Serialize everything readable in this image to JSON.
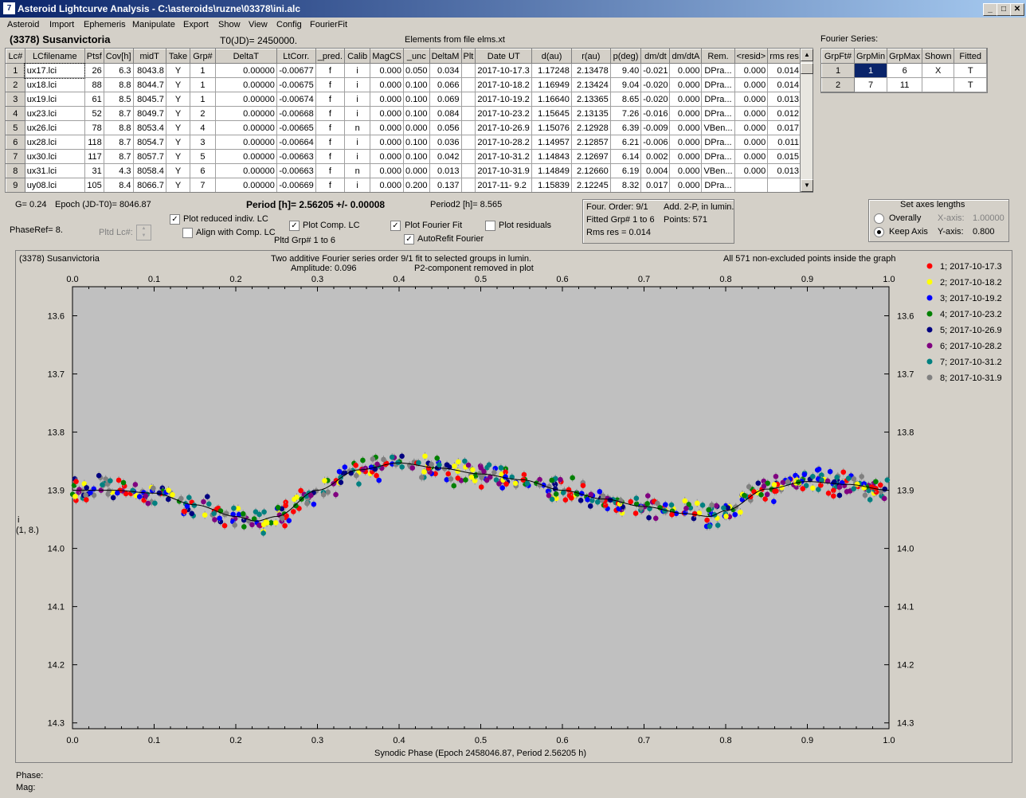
{
  "window": {
    "title": "Asteroid Lightcurve Analysis - C:\\asteroids\\ruzne\\03378\\ini.alc",
    "app_icon": "7",
    "minimize_icon": "_",
    "maximize_icon": "□",
    "close_icon": "✕"
  },
  "menu": [
    "Asteroid",
    "Import",
    "Ephemeris",
    "Manipulate",
    "Export",
    "Show",
    "View",
    "Config",
    "FourierFit"
  ],
  "header": {
    "asteroid_name": "(3378) Susanvictoria",
    "t0": "T0(JD)= 2450000.",
    "elements": "Elements from file elms.xt"
  },
  "lc_table": {
    "columns": [
      "Lc#",
      "LCfilename",
      "Ptsf",
      "Cov[h]",
      "midT",
      "Take",
      "Grp#",
      "DeltaT",
      "LtCorr.",
      "_pred.",
      "Calib",
      "MagCS",
      "_unc",
      "DeltaM",
      "Plt",
      "Date UT",
      "d(au)",
      "r(au)",
      "p(deg)",
      "dm/dt",
      "dm/dtA",
      "Rem.",
      "<resid>",
      "rms res"
    ],
    "rows": [
      [
        "1",
        "ux17.lci",
        "26",
        "6.3",
        "8043.8",
        "Y",
        "1",
        "0.00000",
        "-0.00677",
        "f",
        "i",
        "0.000",
        "0.050",
        "0.034",
        "",
        "2017-10-17.3",
        "1.17248",
        "2.13478",
        "9.40",
        "-0.021",
        "0.000",
        "DPra...",
        "0.000",
        "0.014"
      ],
      [
        "2",
        "ux18.lci",
        "88",
        "8.8",
        "8044.7",
        "Y",
        "1",
        "0.00000",
        "-0.00675",
        "f",
        "i",
        "0.000",
        "0.100",
        "0.066",
        "",
        "2017-10-18.2",
        "1.16949",
        "2.13424",
        "9.04",
        "-0.020",
        "0.000",
        "DPra...",
        "0.000",
        "0.014"
      ],
      [
        "3",
        "ux19.lci",
        "61",
        "8.5",
        "8045.7",
        "Y",
        "1",
        "0.00000",
        "-0.00674",
        "f",
        "i",
        "0.000",
        "0.100",
        "0.069",
        "",
        "2017-10-19.2",
        "1.16640",
        "2.13365",
        "8.65",
        "-0.020",
        "0.000",
        "DPra...",
        "0.000",
        "0.013"
      ],
      [
        "4",
        "ux23.lci",
        "52",
        "8.7",
        "8049.7",
        "Y",
        "2",
        "0.00000",
        "-0.00668",
        "f",
        "i",
        "0.000",
        "0.100",
        "0.084",
        "",
        "2017-10-23.2",
        "1.15645",
        "2.13135",
        "7.26",
        "-0.016",
        "0.000",
        "DPra...",
        "0.000",
        "0.012"
      ],
      [
        "5",
        "ux26.lci",
        "78",
        "8.8",
        "8053.4",
        "Y",
        "4",
        "0.00000",
        "-0.00665",
        "f",
        "n",
        "0.000",
        "0.000",
        "0.056",
        "",
        "2017-10-26.9",
        "1.15076",
        "2.12928",
        "6.39",
        "-0.009",
        "0.000",
        "VBen...",
        "0.000",
        "0.017"
      ],
      [
        "6",
        "ux28.lci",
        "118",
        "8.7",
        "8054.7",
        "Y",
        "3",
        "0.00000",
        "-0.00664",
        "f",
        "i",
        "0.000",
        "0.100",
        "0.036",
        "",
        "2017-10-28.2",
        "1.14957",
        "2.12857",
        "6.21",
        "-0.006",
        "0.000",
        "DPra...",
        "0.000",
        "0.011"
      ],
      [
        "7",
        "ux30.lci",
        "117",
        "8.7",
        "8057.7",
        "Y",
        "5",
        "0.00000",
        "-0.00663",
        "f",
        "i",
        "0.000",
        "0.100",
        "0.042",
        "",
        "2017-10-31.2",
        "1.14843",
        "2.12697",
        "6.14",
        "0.002",
        "0.000",
        "DPra...",
        "0.000",
        "0.015"
      ],
      [
        "8",
        "ux31.lci",
        "31",
        "4.3",
        "8058.4",
        "Y",
        "6",
        "0.00000",
        "-0.00663",
        "f",
        "n",
        "0.000",
        "0.000",
        "0.013",
        "",
        "2017-10-31.9",
        "1.14849",
        "2.12660",
        "6.19",
        "0.004",
        "0.000",
        "VBen...",
        "0.000",
        "0.013"
      ],
      [
        "9",
        "uy08.lci",
        "105",
        "8.4",
        "8066.7",
        "Y",
        "7",
        "0.00000",
        "-0.00669",
        "f",
        "i",
        "0.000",
        "0.200",
        "0.137",
        "",
        "2017-11- 9.2",
        "1.15839",
        "2.12245",
        "8.32",
        "0.017",
        "0.000",
        "DPra...",
        "",
        ""
      ]
    ]
  },
  "fourier": {
    "title": "Fourier Series:",
    "columns": [
      "GrpFt#",
      "GrpMin",
      "GrpMax",
      "Shown",
      "Fitted"
    ],
    "rows": [
      [
        "1",
        "1",
        "6",
        "X",
        "T"
      ],
      [
        "2",
        "7",
        "11",
        "",
        "T"
      ]
    ]
  },
  "controls": {
    "g": "G= 0.24",
    "epoch": "Epoch (JD-T0)= 8046.87",
    "period": "Period [h]= 2.56205 +/- 0.00008",
    "period2": "Period2 [h]= 8.565",
    "phaseref": "PhaseRef= 8.",
    "pltd_lc": "Pltd Lc#:",
    "plot_reduced": "Plot reduced indiv. LC",
    "align_comp": "Align with Comp. LC",
    "plot_comp": "Plot Comp. LC",
    "pltd_grp": "Pltd Grp#  1   to   6",
    "plot_fourier": "Plot Fourier Fit",
    "autorefit": "AutoRefit Fourier",
    "plot_residuals": "Plot residuals",
    "check_mark": "✓",
    "four_order": "Four. Order:  9/1",
    "add2p": "Add. 2-P, in lumin.",
    "fitted_grp": "Fitted Grp# 1 to 6",
    "points": "Points: 571",
    "rms": "Rms res     = 0.014",
    "axes_title": "Set axes lengths",
    "overally": "Overally",
    "keep_axis": "Keep Axis",
    "xaxis_lbl": "X-axis:",
    "xaxis_val": "1.00000",
    "yaxis_lbl": "Y-axis:",
    "yaxis_val": "0.800",
    "phase_lbl": "Phase:",
    "mag_lbl": "Mag:"
  },
  "plot": {
    "top_left": "(3378) Susanvictoria",
    "top_center1": "Two additive Fourier series order 9/1 fit to selected groups in lumin.",
    "top_center2a": "Amplitude: 0.096",
    "top_center2b": "P2-component removed in plot",
    "top_right": "All 571 non-excluded points inside the graph",
    "ylabel1": "i",
    "ylabel2": "(1, 8.)"
  },
  "chart_data": {
    "type": "scatter",
    "xlabel": "Synodic Phase (Epoch 2458046.87, Period 2.56205 h)",
    "ylabel": "i (1, 8.)",
    "xlim": [
      0.0,
      1.0
    ],
    "ylim": [
      13.55,
      14.31
    ],
    "y_inverted": true,
    "x_ticks": [
      "0.0",
      "0.1",
      "0.2",
      "0.3",
      "0.4",
      "0.5",
      "0.6",
      "0.7",
      "0.8",
      "0.9",
      "1.0"
    ],
    "y_ticks": [
      "13.6",
      "13.7",
      "13.8",
      "13.9",
      "14.0",
      "14.1",
      "14.2",
      "14.3"
    ],
    "legend_position": "right",
    "fit_curve": {
      "x": [
        0.0,
        0.05,
        0.1,
        0.15,
        0.2,
        0.225,
        0.25,
        0.3,
        0.35,
        0.4,
        0.45,
        0.5,
        0.55,
        0.6,
        0.65,
        0.7,
        0.75,
        0.78,
        0.8,
        0.85,
        0.9,
        0.95,
        1.0
      ],
      "y": [
        13.9,
        13.9,
        13.905,
        13.925,
        13.945,
        13.953,
        13.945,
        13.9,
        13.865,
        13.853,
        13.862,
        13.872,
        13.882,
        13.9,
        13.915,
        13.928,
        13.94,
        13.945,
        13.935,
        13.898,
        13.885,
        13.89,
        13.9
      ]
    },
    "series": [
      {
        "name": "1; 2017-10-17.3",
        "color": "#ff0000"
      },
      {
        "name": "2; 2017-10-18.2",
        "color": "#ffff00"
      },
      {
        "name": "3; 2017-10-19.2",
        "color": "#0000ff"
      },
      {
        "name": "4; 2017-10-23.2",
        "color": "#008000"
      },
      {
        "name": "5; 2017-10-26.9",
        "color": "#000080"
      },
      {
        "name": "6; 2017-10-28.2",
        "color": "#800080"
      },
      {
        "name": "7; 2017-10-31.2",
        "color": "#008080"
      },
      {
        "name": "8; 2017-10-31.9",
        "color": "#808080"
      }
    ]
  }
}
